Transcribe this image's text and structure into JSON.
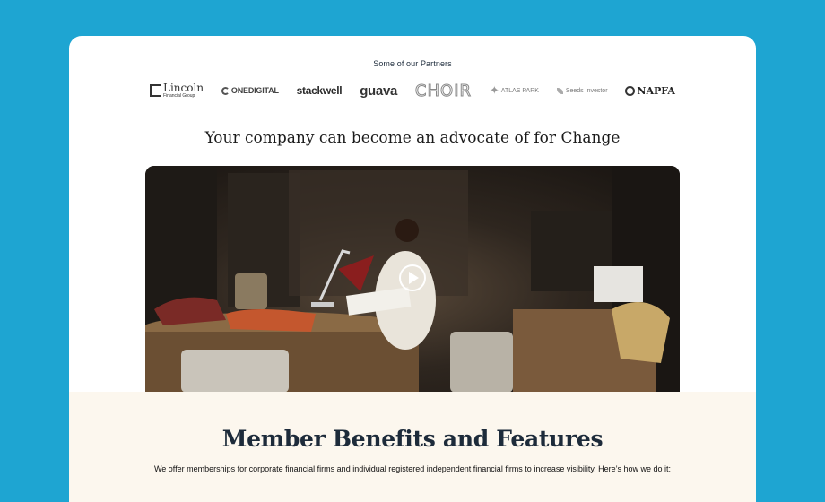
{
  "partners": {
    "label": "Some of our Partners",
    "logos": [
      {
        "name": "Lincoln",
        "sub": "Financial Group"
      },
      {
        "name": "ONEDIGITAL"
      },
      {
        "name": "stackwell"
      },
      {
        "name": "guava"
      },
      {
        "name": "CHOIR"
      },
      {
        "name": "ATLAS PARK"
      },
      {
        "name": "Seeds Investor"
      },
      {
        "name": "NAPFA"
      }
    ]
  },
  "hero": {
    "headline": "Your company can become an advocate of for Change"
  },
  "video": {
    "icon": "play-icon"
  },
  "benefits": {
    "title": "Member Benefits and Features",
    "description": "We offer memberships for corporate financial firms and individual registered independent financial firms to increase visibility. Here’s how we do it:"
  },
  "colors": {
    "background": "#1ea5d2",
    "card": "#ffffff",
    "benefits_bg": "#fcf7ee",
    "heading": "#1d2b3a"
  }
}
